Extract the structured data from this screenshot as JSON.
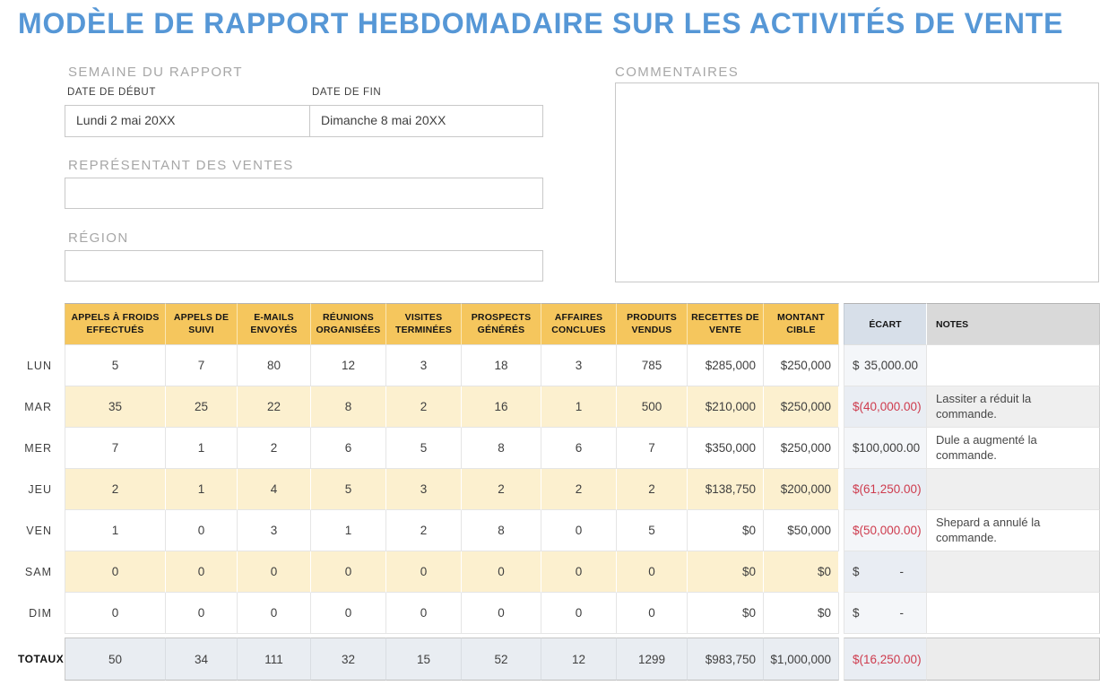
{
  "title": "MODÈLE DE RAPPORT HEBDOMADAIRE SUR LES ACTIVITÉS DE VENTE",
  "form": {
    "week_section_label": "SEMAINE DU RAPPORT",
    "start_date_label": "DATE DE DÉBUT",
    "end_date_label": "DATE DE FIN",
    "start_date_value": "Lundi 2 mai 20XX",
    "end_date_value": "Dimanche 8 mai 20XX",
    "rep_label": "REPRÉSENTANT DES VENTES",
    "rep_value": "",
    "region_label": "RÉGION",
    "region_value": "",
    "comments_label": "COMMENTAIRES",
    "comments_value": ""
  },
  "table": {
    "columns": [
      "APPELS À FROIDS EFFECTUÉS",
      "APPELS DE SUIVI",
      "E-MAILS ENVOYÉS",
      "RÉUNIONS ORGANISÉES",
      "VISITES TERMINÉES",
      "PROSPECTS GÉNÉRÉS",
      "AFFAIRES CONCLUES",
      "PRODUITS VENDUS",
      "RECETTES DE VENTE",
      "MONTANT CIBLE"
    ],
    "ecart_label": "ÉCART",
    "notes_label": "NOTES",
    "rows": [
      {
        "label": "LUN",
        "values": [
          "5",
          "7",
          "80",
          "12",
          "3",
          "18",
          "3",
          "785",
          "$285,000",
          "$250,000"
        ],
        "ecart": {
          "currency": "$",
          "amount": "35,000.00",
          "negative": false
        },
        "note": ""
      },
      {
        "label": "MAR",
        "values": [
          "35",
          "25",
          "22",
          "8",
          "2",
          "16",
          "1",
          "500",
          "$210,000",
          "$250,000"
        ],
        "ecart": {
          "currency": "$",
          "amount": "(40,000.00)",
          "negative": true
        },
        "note": "Lassiter a réduit la commande."
      },
      {
        "label": "MER",
        "values": [
          "7",
          "1",
          "2",
          "6",
          "5",
          "8",
          "6",
          "7",
          "$350,000",
          "$250,000"
        ],
        "ecart": {
          "currency": "$",
          "amount": "100,000.00",
          "negative": false
        },
        "note": "Dule a augmenté la commande."
      },
      {
        "label": "JEU",
        "values": [
          "2",
          "1",
          "4",
          "5",
          "3",
          "2",
          "2",
          "2",
          "$138,750",
          "$200,000"
        ],
        "ecart": {
          "currency": "$",
          "amount": "(61,250.00)",
          "negative": true
        },
        "note": ""
      },
      {
        "label": "VEN",
        "values": [
          "1",
          "0",
          "3",
          "1",
          "2",
          "8",
          "0",
          "5",
          "$0",
          "$50,000"
        ],
        "ecart": {
          "currency": "$",
          "amount": "(50,000.00)",
          "negative": true
        },
        "note": "Shepard a annulé la commande."
      },
      {
        "label": "SAM",
        "values": [
          "0",
          "0",
          "0",
          "0",
          "0",
          "0",
          "0",
          "0",
          "$0",
          "$0"
        ],
        "ecart": {
          "currency": "$",
          "amount": "-",
          "negative": false
        },
        "note": ""
      },
      {
        "label": "DIM",
        "values": [
          "0",
          "0",
          "0",
          "0",
          "0",
          "0",
          "0",
          "0",
          "$0",
          "$0"
        ],
        "ecart": {
          "currency": "$",
          "amount": "-",
          "negative": false
        },
        "note": ""
      }
    ],
    "totals": {
      "label": "TOTAUX",
      "values": [
        "50",
        "34",
        "111",
        "32",
        "15",
        "52",
        "12",
        "1299",
        "$983,750",
        "$1,000,000"
      ],
      "ecart": {
        "currency": "$",
        "amount": "(16,250.00)",
        "negative": true
      },
      "note": ""
    }
  },
  "colors": {
    "title_blue": "#5697d6",
    "header_yellow": "#f5c65d",
    "row_cream": "#fcf0cf",
    "ecart_header_blue": "#d7dfe9",
    "notes_header_gray": "#d9d9d9",
    "totals_gray_blue": "#e9edf2",
    "negative_red": "#ce3b4d"
  }
}
